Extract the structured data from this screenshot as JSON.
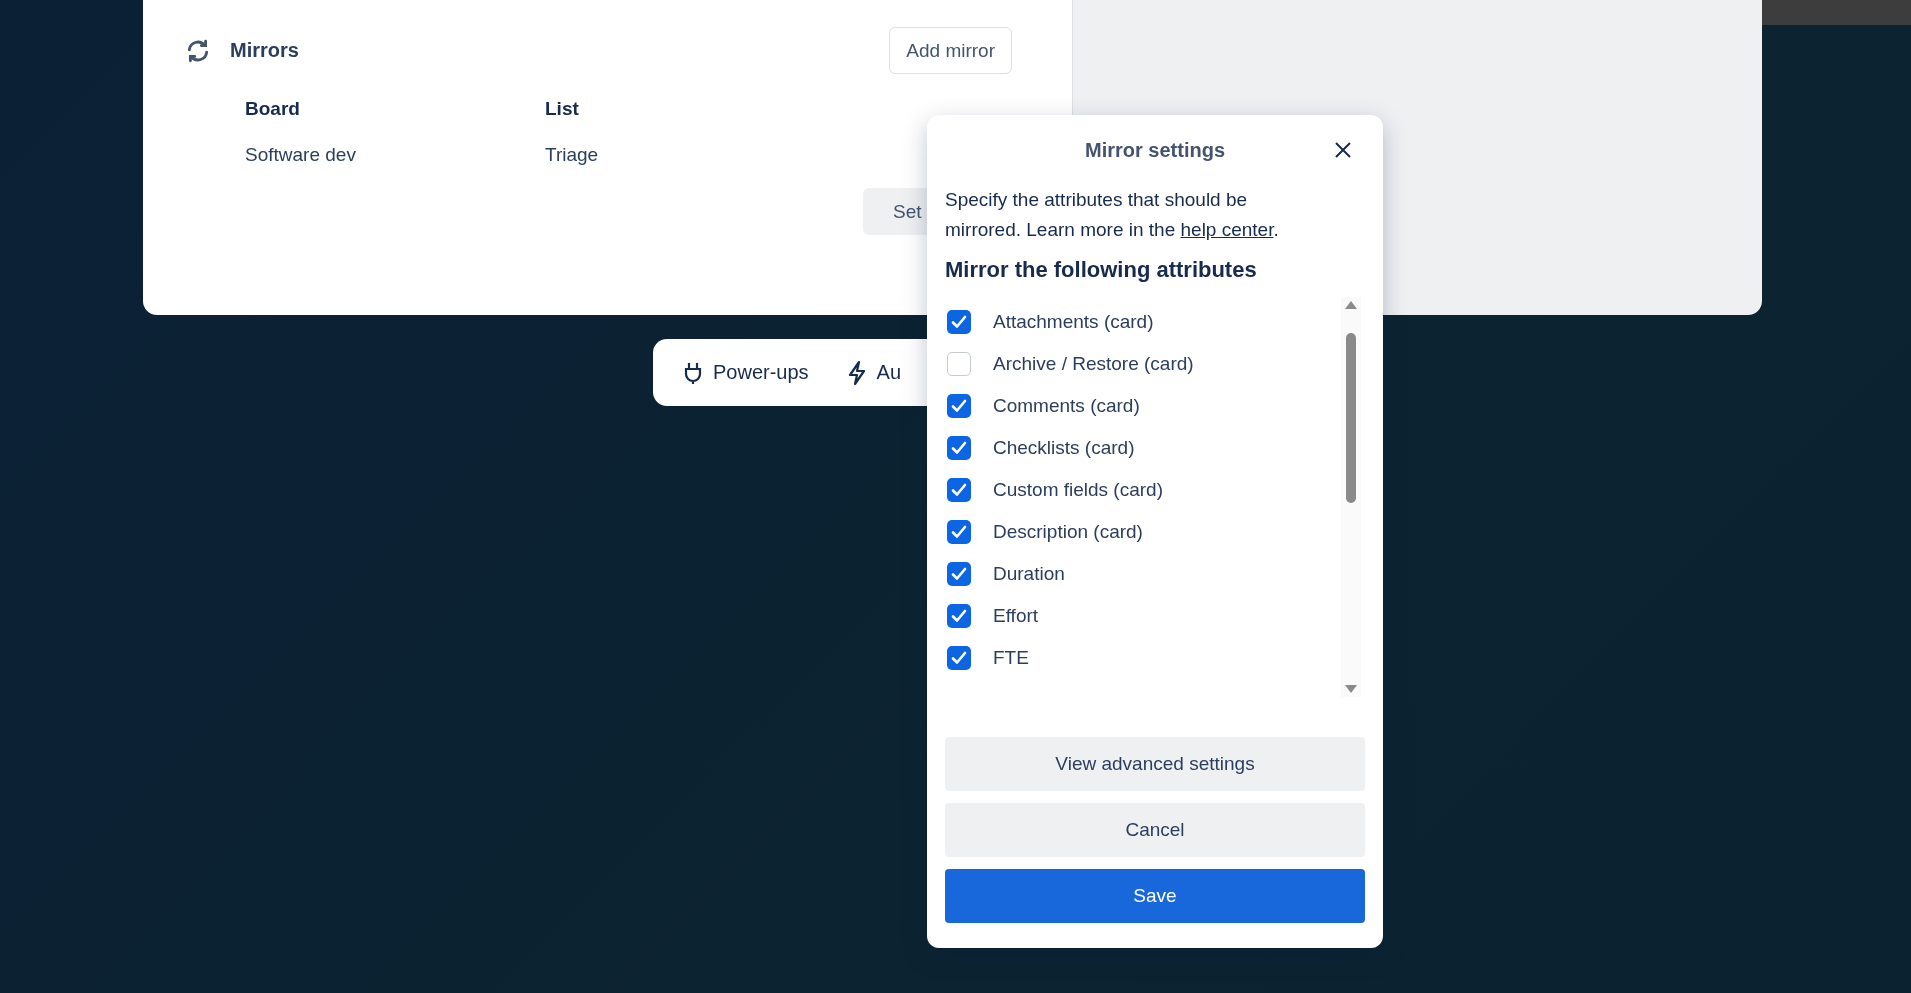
{
  "mirrors": {
    "title": "Mirrors",
    "add_button": "Add mirror",
    "columns": [
      "Board",
      "List"
    ],
    "rows": [
      {
        "board": "Software dev",
        "list": "Triage"
      }
    ],
    "settings_button": "Set"
  },
  "bottom_bar": {
    "items": [
      {
        "kind": "plug",
        "label": "Power-ups"
      },
      {
        "kind": "bolt",
        "label": "Au"
      }
    ]
  },
  "dialog": {
    "title": "Mirror settings",
    "description": "Specify the attributes that should be mirrored. Learn more in the ",
    "link": "help center",
    "description_end": ".",
    "heading": "Mirror the following attributes",
    "attributes": [
      {
        "label": "Attachments (card)",
        "checked": true
      },
      {
        "label": "Archive / Restore (card)",
        "checked": false
      },
      {
        "label": "Comments (card)",
        "checked": true
      },
      {
        "label": "Checklists (card)",
        "checked": true
      },
      {
        "label": "Custom fields (card)",
        "checked": true
      },
      {
        "label": "Description (card)",
        "checked": true
      },
      {
        "label": "Duration",
        "checked": true
      },
      {
        "label": "Effort",
        "checked": true
      },
      {
        "label": "FTE",
        "checked": true
      }
    ],
    "buttons": [
      {
        "kind": "secondary",
        "label": "View advanced settings"
      },
      {
        "kind": "secondary",
        "label": "Cancel"
      },
      {
        "kind": "primary",
        "label": "Save"
      }
    ]
  }
}
